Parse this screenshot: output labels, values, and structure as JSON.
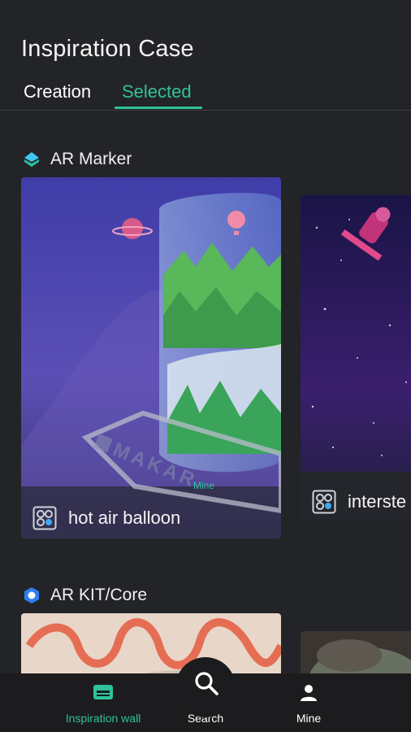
{
  "header": {
    "title": "Inspiration Case"
  },
  "tabs": [
    {
      "label": "Creation",
      "active": false
    },
    {
      "label": "Selected",
      "active": true
    }
  ],
  "sections": [
    {
      "title": "AR Marker",
      "icon": "ar-marker-icon",
      "cards": [
        {
          "name": "hot air balloon",
          "watermark": "MAKAR",
          "tag": "Mine",
          "icon": "ar-grid-icon"
        },
        {
          "name": "interste",
          "icon": "ar-grid-icon"
        }
      ]
    },
    {
      "title": "AR KIT/Core",
      "icon": "ar-kit-icon",
      "cards": []
    }
  ],
  "bottom_nav": {
    "items": [
      {
        "label": "Inspiration wall",
        "icon": "inspiration-wall-icon",
        "active": true
      },
      {
        "label": "Search",
        "icon": "search-icon",
        "active": false
      },
      {
        "label": "Mine",
        "icon": "user-icon",
        "active": false
      }
    ]
  },
  "colors": {
    "background": "#232427",
    "accent": "#2fc29b",
    "nav_background": "#1c1c1e"
  }
}
